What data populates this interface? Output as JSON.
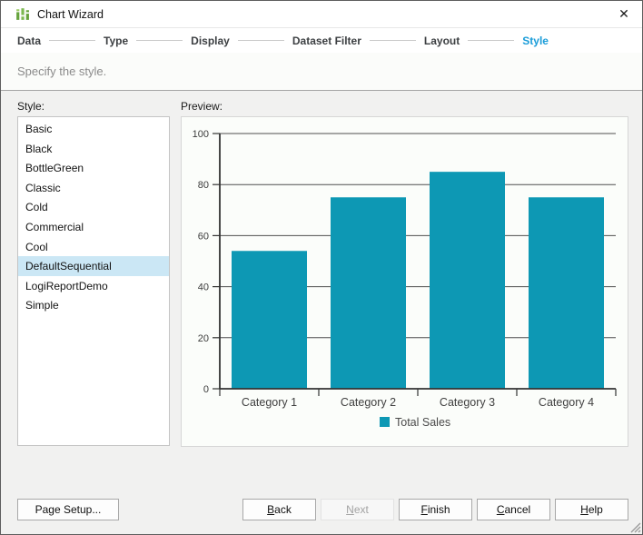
{
  "window": {
    "title": "Chart Wizard"
  },
  "icons": {
    "close": "✕",
    "app": "chart-bars-green"
  },
  "steps": {
    "items": [
      {
        "label": "Data",
        "active": false
      },
      {
        "label": "Type",
        "active": false
      },
      {
        "label": "Display",
        "active": false
      },
      {
        "label": "Dataset Filter",
        "active": false
      },
      {
        "label": "Layout",
        "active": false
      },
      {
        "label": "Style",
        "active": true
      }
    ]
  },
  "subtitle": "Specify the style.",
  "style_panel": {
    "label": "Style:",
    "options": [
      "Basic",
      "Black",
      "BottleGreen",
      "Classic",
      "Cold",
      "Commercial",
      "Cool",
      "DefaultSequential",
      "LogiReportDemo",
      "Simple"
    ],
    "selected": "DefaultSequential"
  },
  "preview_panel": {
    "label": "Preview:"
  },
  "chart_data": {
    "type": "bar",
    "title": "",
    "xlabel": "",
    "ylabel": "",
    "categories": [
      "Category 1",
      "Category 2",
      "Category 3",
      "Category 4"
    ],
    "series": [
      {
        "name": "Total Sales",
        "values": [
          54,
          75,
          85,
          75
        ]
      }
    ],
    "ylim": [
      0,
      100
    ],
    "yticks": [
      0,
      20,
      40,
      60,
      80,
      100
    ],
    "grid": true,
    "legend_position": "bottom",
    "bar_color": "#0d98b4"
  },
  "footer": {
    "page_setup_label": "Page Setup...",
    "buttons": [
      {
        "name": "back",
        "mnemonic": "B",
        "rest": "ack",
        "disabled": false
      },
      {
        "name": "next",
        "mnemonic": "N",
        "rest": "ext",
        "disabled": true
      },
      {
        "name": "finish",
        "mnemonic": "F",
        "rest": "inish",
        "disabled": false
      },
      {
        "name": "cancel",
        "mnemonic": "C",
        "rest": "ancel",
        "disabled": false
      },
      {
        "name": "help",
        "mnemonic": "H",
        "rest": "elp",
        "disabled": false
      }
    ]
  },
  "colors": {
    "accent_blue": "#1b9dd9",
    "selection_bg": "#cbe7f5",
    "bar_teal": "#0d98b4",
    "app_icon_green": "#66a33c",
    "gridline": "#4f4f4f"
  }
}
